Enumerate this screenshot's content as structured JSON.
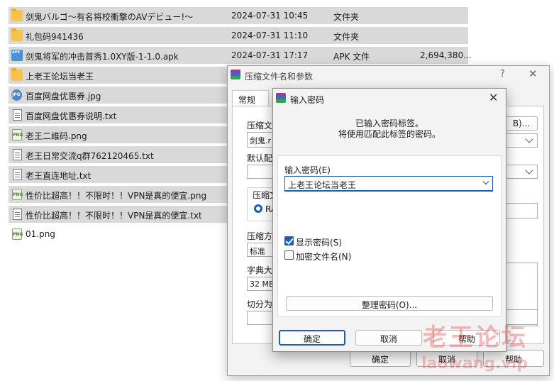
{
  "files": [
    {
      "name": "剑鬼バルゴ～有名将校衝撃のAVデビュー!～",
      "date": "2024-07-31 10:45",
      "type": "文件夹",
      "size": "",
      "icon": "folder-icon",
      "selected": true
    },
    {
      "name": "礼包码941436",
      "date": "2024-07-31 11:10",
      "type": "文件夹",
      "size": "",
      "icon": "folder-icon",
      "selected": true
    },
    {
      "name": "剑鬼将军的冲击首秀1.0XY版-1-1.0.apk",
      "date": "2024-07-31 17:17",
      "type": "APK 文件",
      "size": "2,694,380...",
      "icon": "apk-icon",
      "selected": true
    },
    {
      "name": "上老王论坛当老王",
      "date": "",
      "type": "",
      "size": "",
      "icon": "folder-icon",
      "selected": true
    },
    {
      "name": "百度网盘优惠券.jpg",
      "date": "",
      "type": "",
      "size": "",
      "icon": "jpg-icon",
      "selected": true
    },
    {
      "name": "百度网盘优惠券说明.txt",
      "date": "",
      "type": "",
      "size": "",
      "icon": "txt-icon",
      "selected": true
    },
    {
      "name": "老王二维码.png",
      "date": "",
      "type": "",
      "size": "",
      "icon": "png-icon",
      "selected": true
    },
    {
      "name": "老王日常交流q群762120465.txt",
      "date": "",
      "type": "",
      "size": "",
      "icon": "txt-icon",
      "selected": true
    },
    {
      "name": "老王直连地址.txt",
      "date": "",
      "type": "",
      "size": "",
      "icon": "txt-icon",
      "selected": true
    },
    {
      "name": "性价比超高！！不限时！！VPN是真的便宜.png",
      "date": "",
      "type": "",
      "size": "",
      "icon": "png-icon",
      "selected": true
    },
    {
      "name": "性价比超高！！不限时！！VPN是真的便宜.txt",
      "date": "",
      "type": "",
      "size": "",
      "icon": "txt-icon",
      "selected": true
    },
    {
      "name": "01.png",
      "date": "",
      "type": "",
      "size": "",
      "icon": "png-icon",
      "selected": false
    }
  ],
  "icon_glyphs": {
    "apk": "APK",
    "jpg": "JPG",
    "png": "PNG"
  },
  "back_dialog": {
    "title": "压缩文件名和参数",
    "help": "?",
    "close": "✕",
    "tab_general": "常规",
    "archive_name_label": "压缩文",
    "archive_name_value": "剑鬼.r",
    "browse_button": "B)...",
    "default_profile_label": "默认配",
    "format_label": "压缩文",
    "format_option": "RA",
    "method_label": "压缩方",
    "method_value": "标准",
    "dict_label": "字典大",
    "dict_value": "32 MB",
    "split_label": "切分为",
    "ok": "确定",
    "cancel": "取消",
    "help_button": "帮助"
  },
  "front_dialog": {
    "title": "输入密码",
    "close": "✕",
    "info_line1": "已输入密码标签。",
    "info_line2": "将使用匹配此标签的密码。",
    "password_label": "输入密码(E)",
    "password_value": "上老王论坛当老王",
    "show_password": "显示密码(S)",
    "show_password_checked": true,
    "encrypt_names": "加密文件名(N)",
    "encrypt_names_checked": false,
    "organize_button": "整理密码(O)...",
    "ok": "确定",
    "cancel": "取消",
    "help": "帮助"
  },
  "watermark": {
    "line1": "老王论坛",
    "line2": "laowang.vip"
  },
  "colors": {
    "selection": "#d9d9d9",
    "accent": "#1a5fb4",
    "folder": "#f6c24a",
    "watermark": "#dc3c3c"
  }
}
